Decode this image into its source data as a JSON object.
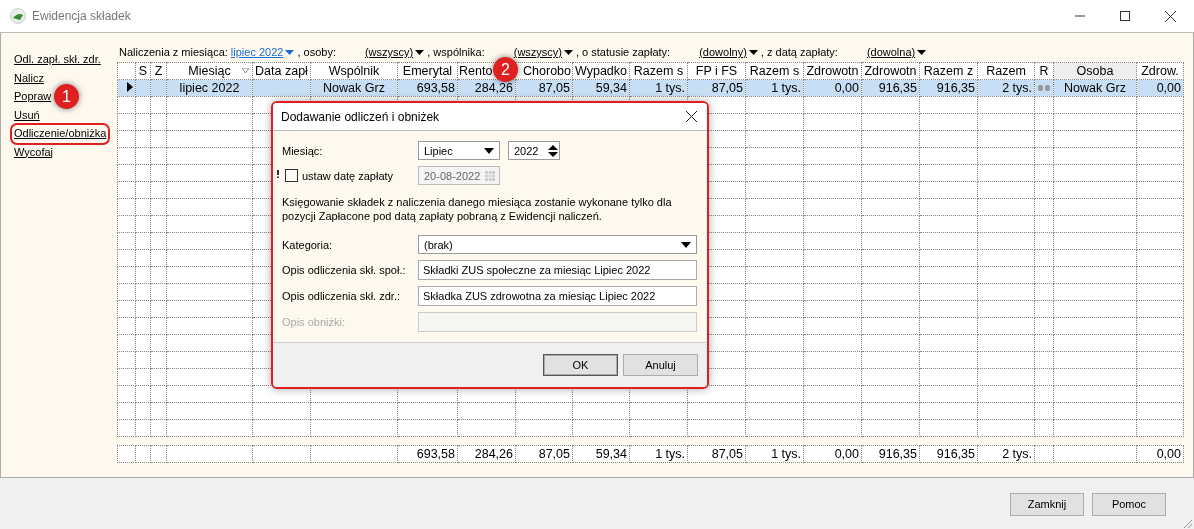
{
  "window": {
    "title": "Ewidencja składek"
  },
  "sidebar": {
    "items": [
      {
        "label": "Odl. zapł. skł. zdr.",
        "highlighted": false
      },
      {
        "label": "Nalicz",
        "highlighted": false
      },
      {
        "label": "Popraw",
        "highlighted": false
      },
      {
        "label": "Usuń",
        "highlighted": false
      },
      {
        "label": "Odliczenie/obniżka",
        "highlighted": true
      },
      {
        "label": "Wycofaj",
        "highlighted": false
      }
    ]
  },
  "filters": [
    {
      "label": "Naliczenia z miesiąca:",
      "value": "lipiec 2022",
      "kind": "link"
    },
    {
      "label": ", osoby:",
      "value": "(wszyscy)",
      "kind": "dropdown"
    },
    {
      "label": ", wspólnika:",
      "value": "(wszyscy)",
      "kind": "dropdown"
    },
    {
      "label": ", o statusie zapłaty:",
      "value": "(dowolny)",
      "kind": "dropdown"
    },
    {
      "label": ", z datą zapłaty:",
      "value": "(dowolna)",
      "kind": "dropdown"
    }
  ],
  "table": {
    "columns": [
      {},
      {
        "label": "S"
      },
      {
        "label": "Z"
      },
      {
        "label": "Miesiąc",
        "sorted": true
      },
      {
        "label": "Data zapł"
      },
      {
        "label": "Wspólnik"
      },
      {
        "label": "Emerytal"
      },
      {
        "label": "Rento"
      },
      {
        "label": "Chorobo"
      },
      {
        "label": "Wypadko"
      },
      {
        "label": "Razem s"
      },
      {
        "label": "FP i FS"
      },
      {
        "label": "Razem s"
      },
      {
        "label": "Zdrowotn"
      },
      {
        "label": "Zdrowotn"
      },
      {
        "label": "Razem z"
      },
      {
        "label": "Razem"
      },
      {
        "label": "R"
      },
      {
        "label": "Osoba"
      },
      {
        "label": "Zdrow."
      }
    ],
    "rows": [
      {
        "selected": true,
        "r_marker": true,
        "cells": [
          null,
          null,
          null,
          "lipiec 2022",
          null,
          "Nowak Grz",
          "693,58",
          "284,26",
          "87,05",
          "59,34",
          "1 tys.",
          "87,05",
          "1 tys.",
          "0,00",
          "916,35",
          "916,35",
          "2 tys.",
          null,
          "Nowak Grz",
          "0,00"
        ]
      }
    ],
    "footer_row": {
      "cells": [
        null,
        null,
        null,
        null,
        null,
        null,
        "693,58",
        "284,26",
        "87,05",
        "59,34",
        "1 tys.",
        "87,05",
        "1 tys.",
        "0,00",
        "916,35",
        "916,35",
        "2 tys.",
        null,
        null,
        "0,00"
      ]
    }
  },
  "dialog": {
    "title": "Dodawanie odliczeń i obniżek",
    "month": {
      "label": "Miesiąc:",
      "value": "Lipiec",
      "year": "2022"
    },
    "pay_date": {
      "label": "ustaw datę zapłaty",
      "checked": false,
      "value": "20-08-2022",
      "disabled": true
    },
    "note": "Księgowanie składek z naliczenia danego miesiąca zostanie wykonane tylko dla pozycji Zapłacone pod datą zapłaty pobraną z Ewidencji naliczeń.",
    "category": {
      "label": "Kategoria:",
      "value": "(brak)"
    },
    "fields": [
      {
        "label": "Opis odliczenia skł. społ.:",
        "value": "Składki ZUS społeczne za miesiąc Lipiec 2022",
        "disabled": false
      },
      {
        "label": "Opis odliczenia skł. zdr.:",
        "value": "Składka ZUS zdrowotna za miesiąc Lipiec 2022",
        "disabled": false
      },
      {
        "label": "Opis obniżki:",
        "disabled": true
      }
    ],
    "buttons": [
      {
        "label": "OK",
        "selected": true
      },
      {
        "label": "Anuluj",
        "selected": false
      }
    ]
  },
  "callouts": [
    {
      "label": "1"
    },
    {
      "label": "2"
    }
  ],
  "buttons": [
    "Zamknij",
    "Pomoc"
  ]
}
